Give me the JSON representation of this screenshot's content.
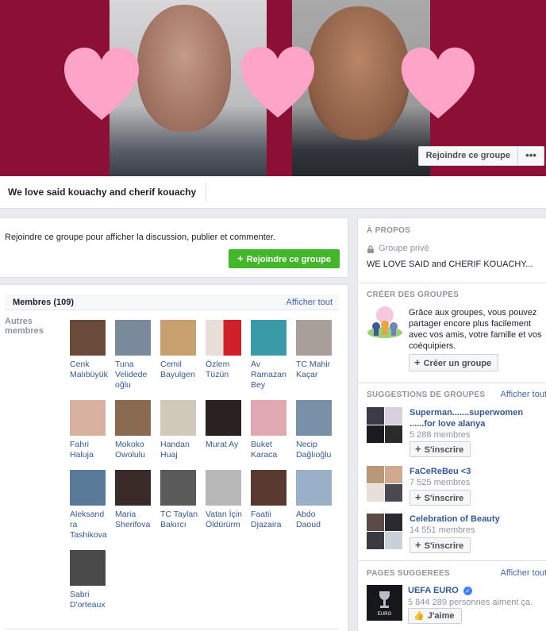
{
  "cover": {
    "join_label": "Rejoindre ce groupe",
    "more_label": "•••"
  },
  "group": {
    "name": "We love said kouachy and cherif kouachy"
  },
  "join_prompt": {
    "text": "Rejoindre ce groupe pour afficher la discussion, publier et commenter.",
    "button_label": "Rejoindre ce groupe"
  },
  "members": {
    "title": "Membres (109)",
    "see_all": "Afficher tout",
    "others_label": "Autres membres",
    "list": [
      {
        "name": "Cenk Malıbüyük",
        "color": "#6a4a3a"
      },
      {
        "name": "Tuna Velidede oğlu",
        "color": "#7a8a9a"
      },
      {
        "name": "Cemil Bayulgen",
        "color": "#c8a070"
      },
      {
        "name": "Özlem Tüzün",
        "color": "#c8303a"
      },
      {
        "name": "Av Ramazan Bey",
        "color": "#3a9aa8"
      },
      {
        "name": "TC Mahir Kaçar",
        "color": "#a8a098"
      },
      {
        "name": "Fahri Haluja",
        "color": "#d8b0a0"
      },
      {
        "name": "Mokoko Owolulu",
        "color": "#8a6a50"
      },
      {
        "name": "Handan Huaj",
        "color": "#d0c8b8"
      },
      {
        "name": "Murat Ay",
        "color": "#2a2220"
      },
      {
        "name": "Buket Karaca",
        "color": "#e0a8b0"
      },
      {
        "name": "Necip Dağlıoğlu",
        "color": "#7890a8"
      },
      {
        "name": "Aleksand ra Tashikova",
        "color": "#5a7a9a"
      },
      {
        "name": "Maria Sherifova",
        "color": "#3a2a28"
      },
      {
        "name": "TC Taylan Bakırcı",
        "color": "#5a5a5a"
      },
      {
        "name": "Vatan İçin Öldürürm",
        "color": "#b8b8b8"
      },
      {
        "name": "Faatii Djazaira",
        "color": "#5a3a30"
      },
      {
        "name": "Abdo Daoud",
        "color": "#9ab0c8"
      },
      {
        "name": "Sabri D'orteaux",
        "color": "#4a4a4a"
      }
    ]
  },
  "about": {
    "title": "À PROPOS",
    "privacy": "Groupe privé",
    "description": "WE LOVE SAID and CHERIF KOUACHY..."
  },
  "create": {
    "title": "CRÉER DES GROUPES",
    "text": "Grâce aux groupes, vous pouvez partager encore plus facilement avec vos amis, votre famille et vos coéquipiers.",
    "button_label": "Créer un groupe"
  },
  "suggestions": {
    "title": "SUGGESTIONS DE GROUPES",
    "see_all": "Afficher tout",
    "join_label": "S'inscrire",
    "items": [
      {
        "name": "Superman.......superwomen ......for love alanya",
        "count": "5 288 membres"
      },
      {
        "name": "FaCeReBeu <3",
        "count": "7 525 membres"
      },
      {
        "name": "Celebration of Beauty",
        "count": "14 551 membres"
      }
    ]
  },
  "pages": {
    "title": "PAGES SUGGEREES",
    "see_all": "Afficher tout",
    "name": "UEFA EURO",
    "likes": "5 844 289 personnes aiment ça.",
    "like_label": "J'aime"
  }
}
